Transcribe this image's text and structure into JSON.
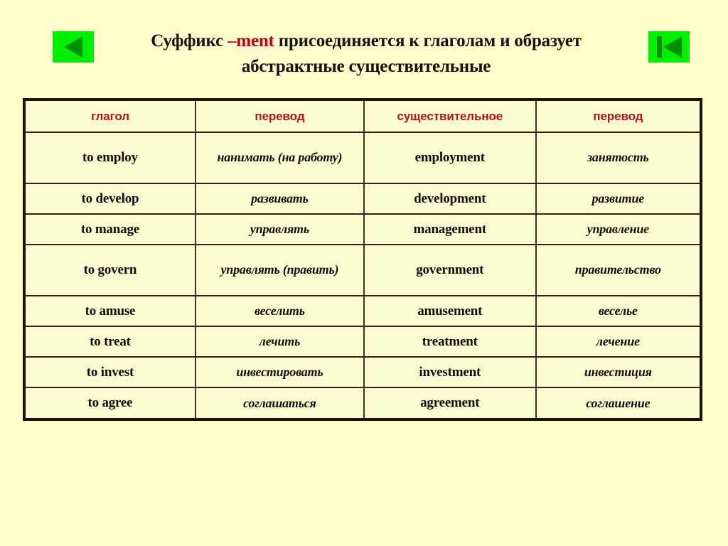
{
  "slide": {
    "background_color": "#ffffcc",
    "title_line_1_before": "Суффикс ",
    "title_accent": "–ment",
    "title_line_1_after": " присоединяется к глаголам и образует",
    "title_line_2": "абстрактные существительные",
    "accent_color": "#c00018"
  },
  "nav": {
    "prev_icon": "triangle-left-icon",
    "first_icon": "skip-to-first-icon",
    "button_color": "#00ee00",
    "glyph_color": "#009000"
  },
  "table": {
    "headers": [
      "глагол",
      "перевод",
      "существительное",
      "перевод"
    ],
    "header_color": "#b4141e",
    "rows": [
      {
        "verb": "to employ",
        "verb_translation": "нанимать (на работу)",
        "noun": "employment",
        "noun_translation": "занятость",
        "tall": true
      },
      {
        "verb": "to develop",
        "verb_translation": "развивать",
        "noun": "development",
        "noun_translation": "развитие",
        "tall": false
      },
      {
        "verb": "to manage",
        "verb_translation": "управлять",
        "noun": "management",
        "noun_translation": "управление",
        "tall": false
      },
      {
        "verb": "to govern",
        "verb_translation": "управлять (править)",
        "noun": "government",
        "noun_translation": "правительство",
        "tall": true
      },
      {
        "verb": "to amuse",
        "verb_translation": "веселить",
        "noun": "amusement",
        "noun_translation": "веселье",
        "tall": false
      },
      {
        "verb": "to treat",
        "verb_translation": "лечить",
        "noun": "treatment",
        "noun_translation": "лечение",
        "tall": false
      },
      {
        "verb": "to invest",
        "verb_translation": "инвестировать",
        "noun": "investment",
        "noun_translation": "инвестиция",
        "tall": false
      },
      {
        "verb": "to agree",
        "verb_translation": "соглашаться",
        "noun": "agreement",
        "noun_translation": "соглашение",
        "tall": false
      }
    ]
  }
}
